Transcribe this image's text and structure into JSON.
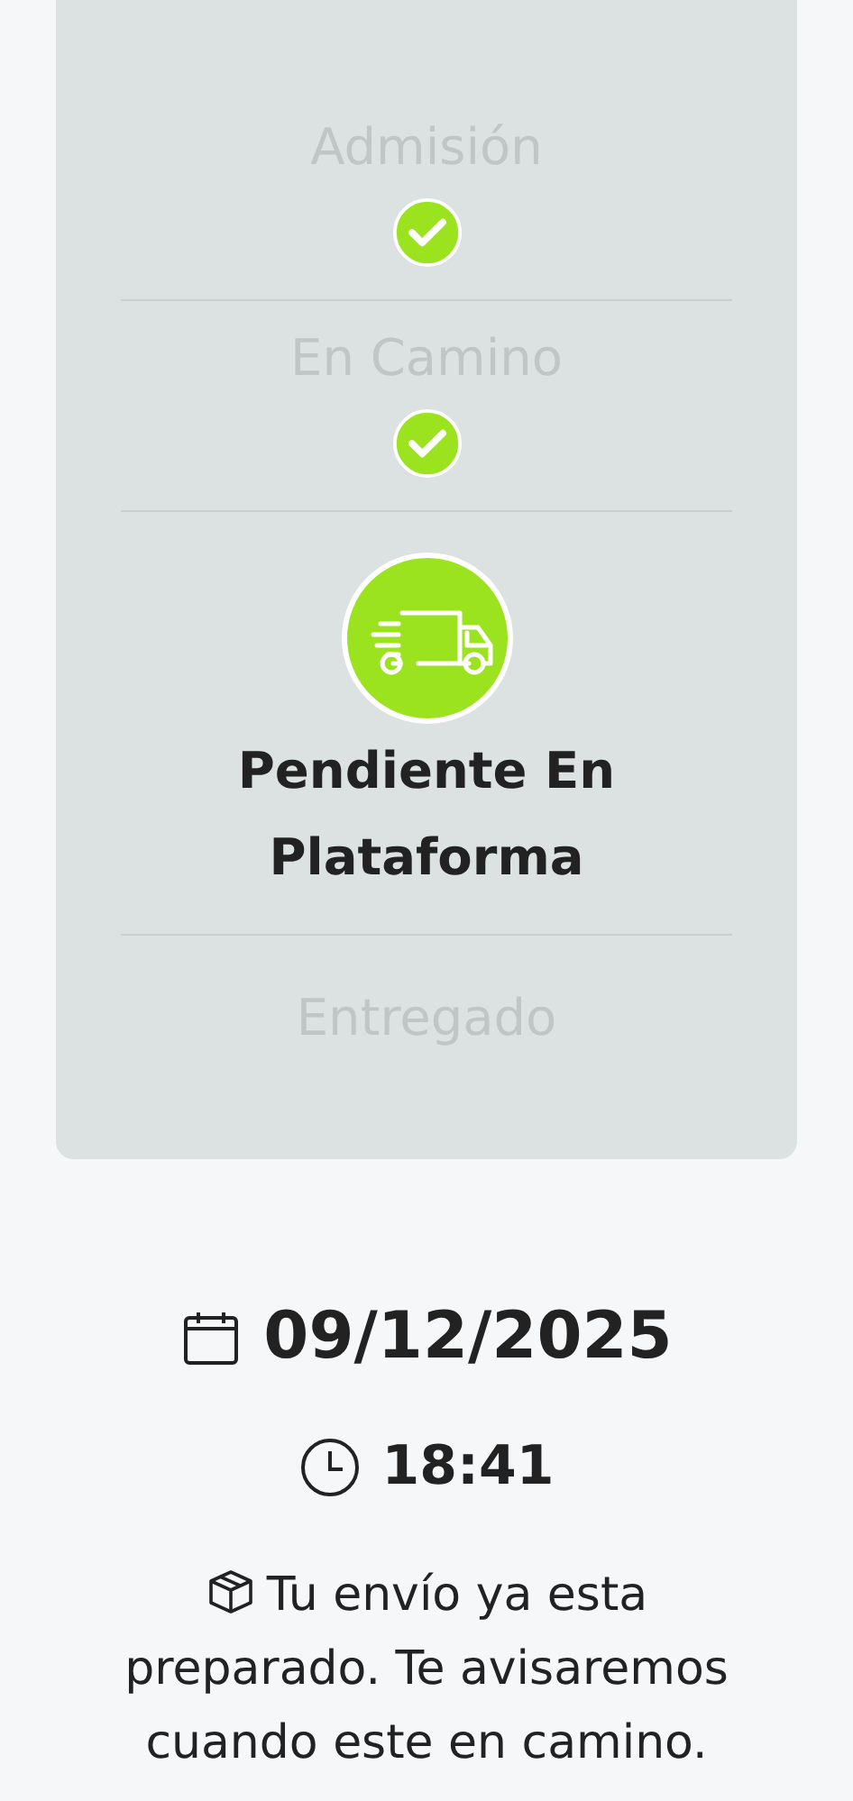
{
  "steps": [
    {
      "label": "Admisión",
      "kind": "done"
    },
    {
      "label": "En Camino",
      "kind": "done"
    },
    {
      "label": "Pendiente En Plataforma",
      "kind": "current"
    },
    {
      "label": "Entregado",
      "kind": "pending"
    }
  ],
  "date": "09/12/2025",
  "time": "18:41",
  "message": "Tu envío ya esta preparado. Te avisaremos cuando este en camino."
}
